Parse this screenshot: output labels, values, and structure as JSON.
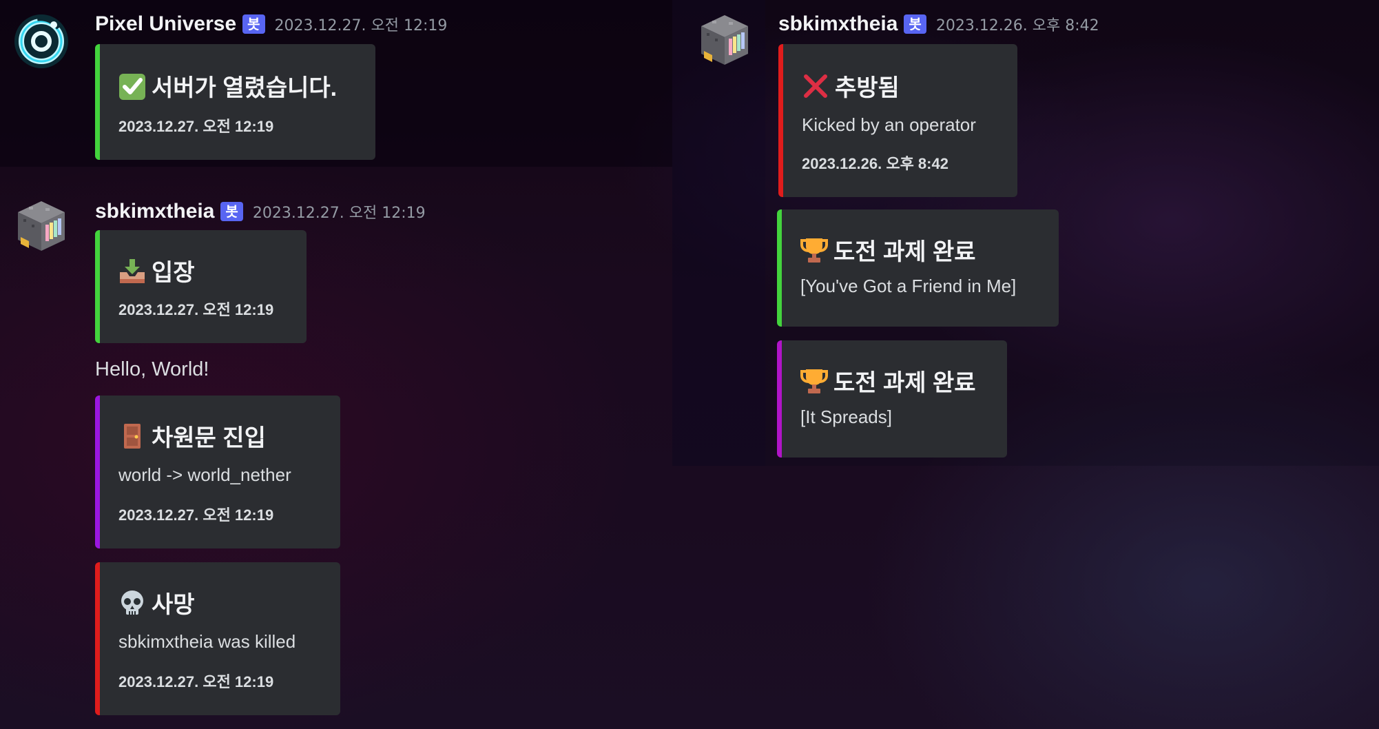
{
  "colors": {
    "green": "#43d33d",
    "red": "#e01c1c",
    "purple": "#9b16e0",
    "magenta": "#b014c8",
    "embed_bg": "#2b2d31",
    "bot_badge": "#5865f2"
  },
  "messages": [
    {
      "author": "Pixel Universe",
      "badge": "봇",
      "timestamp": "2023.12.27. 오전 12:19",
      "avatar_icon": "pixel-universe-ring-icon",
      "embeds": [
        {
          "icon": "check-mark-icon",
          "title": "서버가 열렸습니다.",
          "footer": "2023.12.27. 오전 12:19",
          "accent": "green"
        }
      ]
    },
    {
      "author": "sbkimxtheia",
      "badge": "봇",
      "timestamp": "2023.12.27. 오전 12:19",
      "avatar_icon": "minecraft-block-icon",
      "embeds": [
        {
          "icon": "inbox-tray-icon",
          "title": "입장",
          "footer": "2023.12.27. 오전 12:19",
          "accent": "green"
        },
        {
          "icon": "door-icon",
          "title": "차원문 진입",
          "description": "world -> world_nether",
          "footer": "2023.12.27. 오전 12:19",
          "accent": "purple"
        },
        {
          "icon": "skull-icon",
          "title": "사망",
          "description": "sbkimxtheia was killed",
          "footer": "2023.12.27. 오전 12:19",
          "accent": "red"
        }
      ],
      "content": "Hello, World!"
    },
    {
      "author": "sbkimxtheia",
      "badge": "봇",
      "timestamp": "2023.12.26. 오후 8:42",
      "avatar_icon": "minecraft-block-icon",
      "embeds": [
        {
          "icon": "cross-mark-icon",
          "title": "추방됨",
          "description": "Kicked by an operator",
          "footer": "2023.12.26. 오후 8:42",
          "accent": "red"
        },
        {
          "icon": "trophy-icon",
          "title": "도전 과제 완료",
          "description": "[You've Got a Friend in Me]",
          "accent": "green"
        },
        {
          "icon": "trophy-icon",
          "title": "도전 과제 완료",
          "description": "[It Spreads]",
          "accent": "magenta"
        }
      ]
    }
  ]
}
